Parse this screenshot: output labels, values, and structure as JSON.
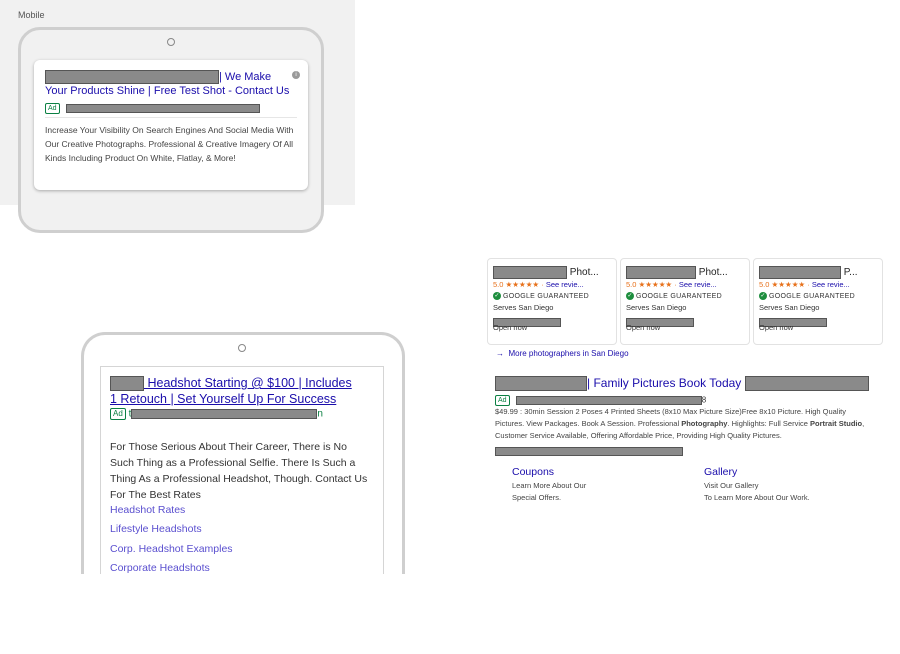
{
  "panel1": {
    "label": "Mobile",
    "ad": {
      "title_part1": "| We Make",
      "title_part2": "Your Products Shine | Free Test Shot - Contact Us",
      "badge": "Ad",
      "info_icon": "info-icon",
      "description": "Increase Your Visibility On Search Engines And Social Media With Our Creative Photographs. Professional & Creative Imagery Of All Kinds Including Product On White, Flatlay, & More!"
    }
  },
  "panel2": {
    "ad": {
      "title_line1": "Headshot Starting @ $100 | Includes",
      "title_line2": "1 Retouch | Set Yourself Up For Success",
      "badge": "Ad",
      "url_start": "t",
      "url_end": "n",
      "description": "For Those Serious About Their Career, There is No Such Thing as a Professional Selfie. There Is Such a Thing As a Professional Headshot, Though. Contact Us For The Best Rates",
      "sitelinks": [
        "Headshot Rates",
        "Lifestyle Headshots",
        "Corp. Headshot Examples",
        "Corporate Headshots"
      ]
    }
  },
  "panel3": {
    "local_cards": [
      {
        "title_suffix": "Phot...",
        "rating": "5.0",
        "stars": "★★★★★",
        "see_reviews": "See revie...",
        "guaranteed": "GOOGLE GUARANTEED",
        "serves": "Serves San Diego",
        "status": "Open now"
      },
      {
        "title_suffix": "Phot...",
        "rating": "5.0",
        "stars": "★★★★★",
        "see_reviews": "See revie...",
        "guaranteed": "GOOGLE GUARANTEED",
        "serves": "Serves San Diego",
        "status": "Open now"
      },
      {
        "title_suffix": "P...",
        "rating": "5.0",
        "stars": "★★★★★",
        "see_reviews": "See revie...",
        "guaranteed": "GOOGLE GUARANTEED",
        "serves": "Serves San Diego",
        "status": "Open now"
      }
    ],
    "more_link": "More photographers in San Diego",
    "ad": {
      "title": "| Family Pictures Book Today",
      "badge": "Ad",
      "url_end": "8",
      "desc_part1": "$49.99 : 30min Session 2 Poses 4 Printed Sheets (8x10 Max Picture Size)Free 8x10 Picture. High Quality Pictures. View Packages. Book A Session. Professional ",
      "desc_bold1": "Photography",
      "desc_part2": ". Highlights: Full Service ",
      "desc_bold2": "Portrait Studio",
      "desc_part3": ", Customer Service Available, Offering Affordable Price, Providing High Quality Pictures.",
      "sitelinks": [
        {
          "title": "Coupons",
          "line1": "Learn More About Our",
          "line2": "Special Offers."
        },
        {
          "title": "Gallery",
          "line1": "Visit Our Gallery",
          "line2": "To Learn More About Our Work."
        }
      ]
    }
  }
}
